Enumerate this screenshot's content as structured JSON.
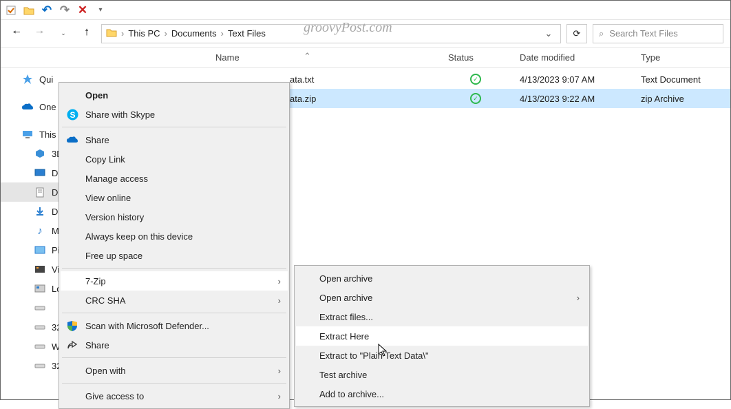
{
  "watermark": "groovyPost.com",
  "breadcrumbs": [
    "This PC",
    "Documents",
    "Text Files"
  ],
  "search": {
    "placeholder": "Search Text Files"
  },
  "columns": {
    "name": "Name",
    "status": "Status",
    "date": "Date modified",
    "type": "Type"
  },
  "sidebar": {
    "items": [
      {
        "label": "Qui",
        "icon": "star-icon"
      },
      {
        "label": "One",
        "icon": "onedrive-icon"
      },
      {
        "label": "This",
        "icon": "pc-icon"
      },
      {
        "label": "3D",
        "icon": "3d-icon"
      },
      {
        "label": "D",
        "icon": "desktop-icon"
      },
      {
        "label": "D",
        "icon": "documents-icon",
        "selected": true
      },
      {
        "label": "D",
        "icon": "downloads-icon"
      },
      {
        "label": "M",
        "icon": "music-icon"
      },
      {
        "label": "Pi",
        "icon": "pictures-icon"
      },
      {
        "label": "Vi",
        "icon": "videos-icon"
      },
      {
        "label": "Lc",
        "icon": "disk-icon"
      },
      {
        "label": "",
        "icon": "drive-icon"
      },
      {
        "label": "32",
        "icon": "drive-icon"
      },
      {
        "label": "W",
        "icon": "drive-icon"
      },
      {
        "label": "32 (",
        "icon": "drive-icon"
      }
    ]
  },
  "files": [
    {
      "name": "ata.txt",
      "date": "4/13/2023 9:07 AM",
      "type": "Text Document",
      "selected": false
    },
    {
      "name": "ata.zip",
      "date": "4/13/2023 9:22 AM",
      "type": "zip Archive",
      "selected": true
    }
  ],
  "context_menu": {
    "items": [
      {
        "label": "Open",
        "bold": true
      },
      {
        "label": "Share with Skype",
        "icon": "skype-icon"
      },
      {
        "sep": true
      },
      {
        "label": "Share",
        "icon": "onedrive-cloud-icon"
      },
      {
        "label": "Copy Link"
      },
      {
        "label": "Manage access"
      },
      {
        "label": "View online"
      },
      {
        "label": "Version history"
      },
      {
        "label": "Always keep on this device"
      },
      {
        "label": "Free up space"
      },
      {
        "sep": true
      },
      {
        "label": "7-Zip",
        "submenu": true,
        "highlight": true
      },
      {
        "label": "CRC SHA",
        "submenu": true
      },
      {
        "sep": true
      },
      {
        "label": "Scan with Microsoft Defender...",
        "icon": "defender-icon"
      },
      {
        "label": "Share",
        "icon": "share-icon"
      },
      {
        "sep": true
      },
      {
        "label": "Open with",
        "submenu": true
      },
      {
        "sep": true
      },
      {
        "label": "Give access to",
        "submenu": true
      }
    ]
  },
  "submenu": {
    "items": [
      {
        "label": "Open archive"
      },
      {
        "label": "Open archive",
        "submenu": true
      },
      {
        "label": "Extract files..."
      },
      {
        "label": "Extract Here",
        "highlight": true
      },
      {
        "label": "Extract to \"Plain Text Data\\\""
      },
      {
        "label": "Test archive"
      },
      {
        "label": "Add to archive..."
      }
    ]
  }
}
